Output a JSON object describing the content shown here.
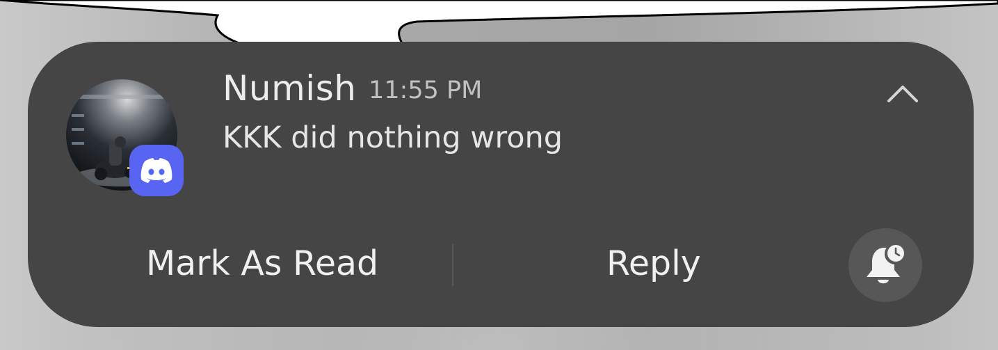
{
  "notification": {
    "sender": "Numish",
    "time": "11:55 PM",
    "message": "KKK did nothing wrong",
    "app_icon": "discord-icon",
    "actions": {
      "mark_read": "Mark As Read",
      "reply": "Reply"
    },
    "snooze_icon": "bell-clock-icon",
    "collapse_icon": "chevron-up-icon"
  },
  "colors": {
    "card_bg": "#454545",
    "app_badge": "#5865f2",
    "speech_bubble": "#ffffff",
    "text_primary": "#ececec",
    "text_secondary": "#c2c2c2"
  }
}
